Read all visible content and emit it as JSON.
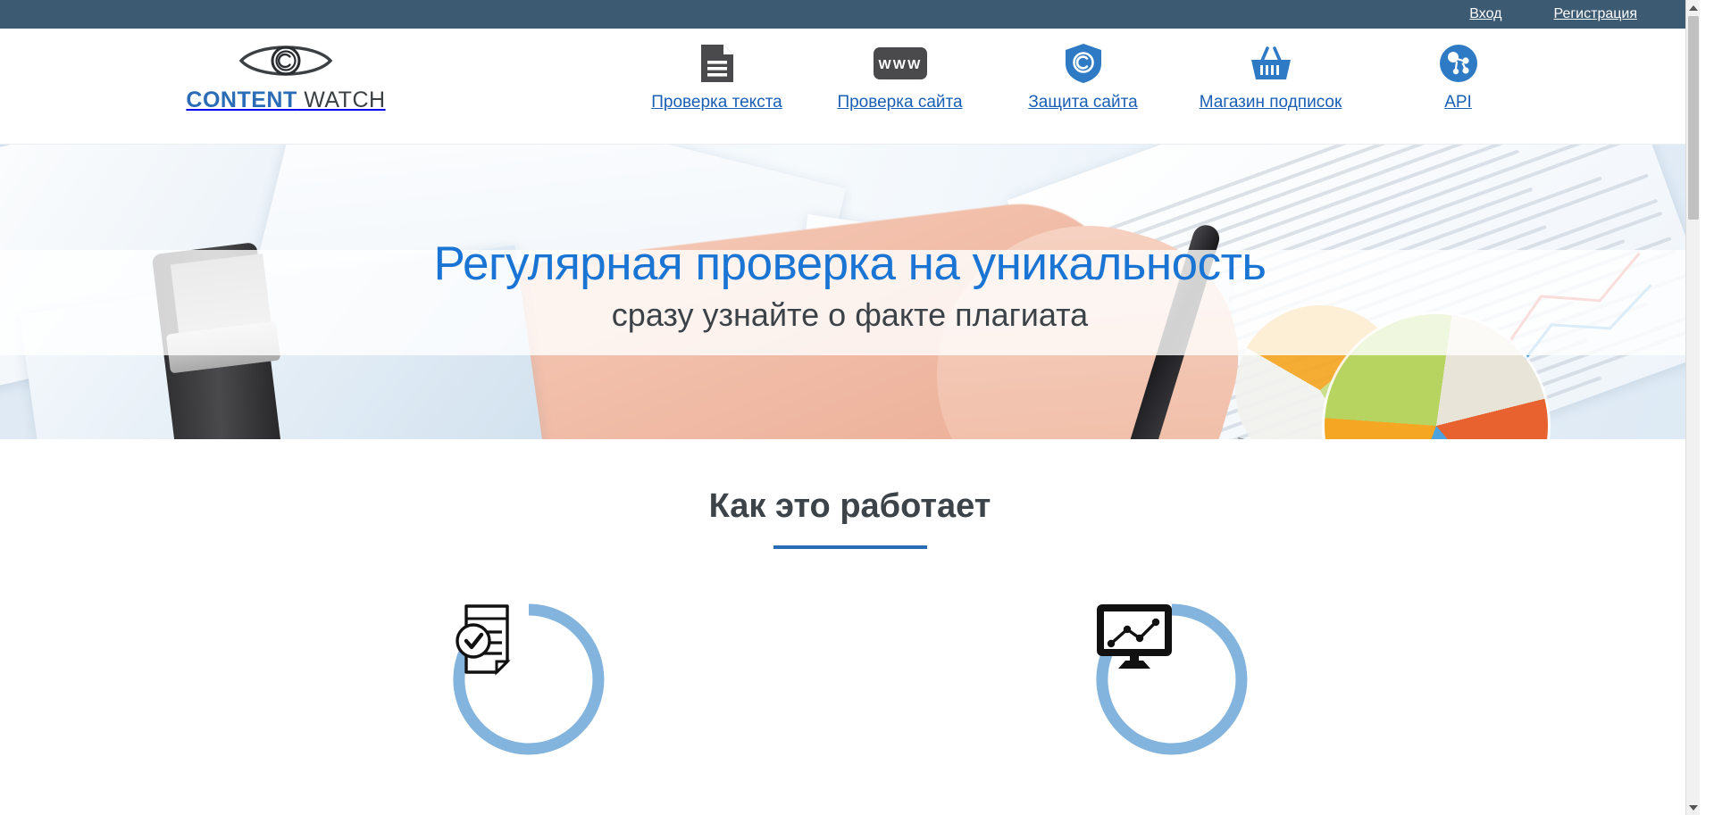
{
  "topbar": {
    "login_label": "Вход",
    "register_label": "Регистрация"
  },
  "brand": {
    "name_first": "CONTENT",
    "name_second": " WATCH",
    "logo_icon": "eye-copyright-icon",
    "color_primary": "#2b6cb7",
    "color_secondary": "#3c4043"
  },
  "nav": {
    "items": [
      {
        "label": "Проверка текста",
        "icon": "document-lines-icon"
      },
      {
        "label": "Проверка сайта",
        "icon": "www-box-icon"
      },
      {
        "label": "Защита сайта",
        "icon": "shield-copyright-icon"
      },
      {
        "label": "Магазин подписок",
        "icon": "shopping-basket-icon"
      },
      {
        "label": "API",
        "icon": "api-network-icon"
      }
    ]
  },
  "hero": {
    "title": "Регулярная проверка на уникальность",
    "subtitle": "сразу узнайте о факте плагиата",
    "title_color": "#1a74d4",
    "subtitle_color": "#3b4248"
  },
  "how_it_works": {
    "heading": "Как это работает",
    "accent_color": "#2b6cb7",
    "ring_color": "#83b4dd",
    "steps": [
      {
        "icon": "document-checkmark-icon"
      },
      {
        "icon": "monitor-chart-icon"
      }
    ]
  },
  "scrollbar": {
    "up_arrow": "scroll-up-arrow",
    "down_arrow": "scroll-down-arrow"
  }
}
